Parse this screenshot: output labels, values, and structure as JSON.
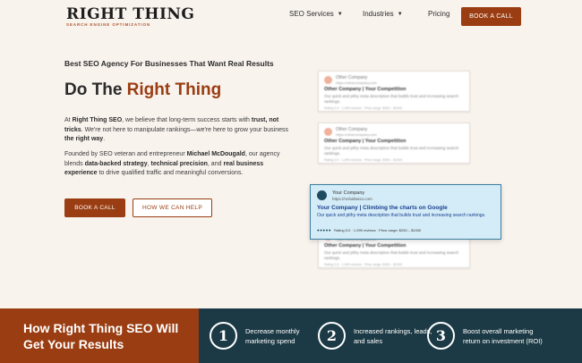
{
  "header": {
    "logo": "RIGHT THING",
    "logo_sub": "SEARCH ENGINE OPTIMIZATION",
    "nav": [
      {
        "label": "SEO Services",
        "has_dropdown": true
      },
      {
        "label": "Industries",
        "has_dropdown": true
      },
      {
        "label": "Pricing",
        "has_dropdown": false
      }
    ],
    "cta": "BOOK A CALL"
  },
  "hero": {
    "tagline": "Best SEO Agency For Businesses That Want Real Results",
    "headline_plain": "Do The ",
    "headline_accent": "Right Thing",
    "para1": {
      "t1": "At ",
      "b1": "Right Thing SEO",
      "t2": ", we believe that long-term success starts with ",
      "b2": "trust, not tricks",
      "t3": ". We're not here to manipulate rankings—we're here to grow your business ",
      "b3": "the right way",
      "t4": "."
    },
    "para2": {
      "t1": "Founded by SEO veteran and entrepreneur ",
      "b1": "Michael McDougald",
      "t2": ", our agency blends ",
      "b2": "data-backed strategy",
      "t3": ", ",
      "b3": "technical precision",
      "t4": ", and ",
      "b4": "real business experience",
      "t5": " to drive qualified traffic and meaningful conversions."
    },
    "btn_primary": "BOOK A CALL",
    "btn_secondary": "HOW WE CAN HELP"
  },
  "serp": {
    "competitor": {
      "name": "Other Company",
      "url": "https://othercompany.com",
      "title": "Other Company | Your Competition",
      "desc": "Our quick and pithy meta description that builds trust and increasing search rankings.",
      "meta": "Rating 3.0 · 1,999 reviews · Price range: $250 – $1000"
    },
    "featured": {
      "name": "Your Company",
      "url": "https://nohallasso.com",
      "title": "Your Company | Climbing the charts on Google",
      "desc": "Our quick and pithy meta description that builds trust and increasing search rankings.",
      "stars": "●●●●●",
      "meta": "Rating 5.0 · 1,999 reviews · Price range: $250 – $1000"
    }
  },
  "results_band": {
    "title": "How Right Thing SEO Will Get Your Results",
    "steps": [
      {
        "num": "1",
        "text": "Decrease monthly marketing spend"
      },
      {
        "num": "2",
        "text": "Increased rankings, leads, and sales"
      },
      {
        "num": "3",
        "text": "Boost overall marketing return on investment (ROI)"
      }
    ]
  },
  "colors": {
    "accent": "#9a3d12",
    "dark_teal": "#1c3a45",
    "background": "#f9f3ee",
    "featured_bg": "#d4ecf7"
  }
}
